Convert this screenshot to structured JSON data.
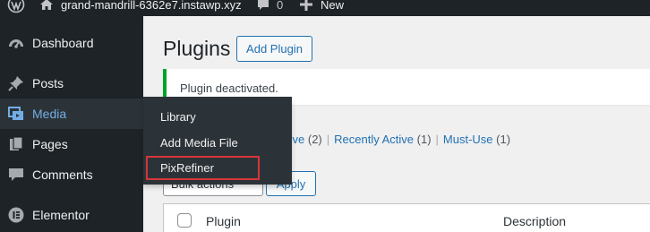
{
  "admin_bar": {
    "site_name": "grand-mandrill-6362e7.instawp.xyz",
    "comments_count": "0",
    "new_label": "New"
  },
  "sidebar": {
    "items": [
      {
        "label": "Dashboard",
        "icon": "dashboard-icon"
      },
      {
        "label": "Posts",
        "icon": "pin-icon"
      },
      {
        "label": "Media",
        "icon": "media-icon"
      },
      {
        "label": "Pages",
        "icon": "pages-icon"
      },
      {
        "label": "Comments",
        "icon": "comments-icon"
      },
      {
        "label": "Elementor",
        "icon": "elementor-icon"
      }
    ],
    "current": "Media"
  },
  "media_flyout": {
    "items": [
      "Library",
      "Add Media File",
      "PixRefiner"
    ],
    "highlighted": "PixRefiner"
  },
  "main": {
    "title": "Plugins",
    "add_plugin_label": "Add Plugin",
    "notice": "Plugin deactivated.",
    "filters": {
      "inactive_partial": "tive",
      "inactive_count": "(2)",
      "recently_active": "Recently Active",
      "recently_active_count": "(1)",
      "must_use": "Must-Use",
      "must_use_count": "(1)"
    },
    "bulk_actions_label": "Bulk actions",
    "apply_label": "Apply",
    "table": {
      "columns": [
        "Plugin",
        "Description"
      ]
    }
  },
  "colors": {
    "sidebar_bg": "#1d2327",
    "flyout_bg": "#2c3338",
    "accent": "#2271b1",
    "current_menu_text": "#72aee6",
    "notice_success": "#00a32a",
    "highlight_outline": "#d63638"
  }
}
